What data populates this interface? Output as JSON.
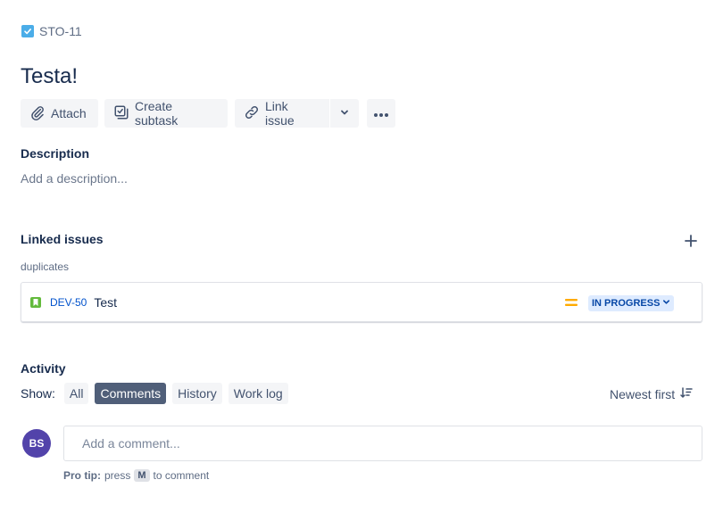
{
  "issue": {
    "key": "STO-11",
    "title": "Testa!"
  },
  "toolbar": {
    "attach_label": "Attach",
    "create_subtask_label": "Create subtask",
    "link_issue_label": "Link issue"
  },
  "description": {
    "heading": "Description",
    "placeholder": "Add a description..."
  },
  "linked_issues": {
    "heading": "Linked issues",
    "link_type": "duplicates",
    "items": [
      {
        "key": "DEV-50",
        "summary": "Test",
        "status": "IN PROGRESS",
        "priority": "medium"
      }
    ]
  },
  "activity": {
    "heading": "Activity",
    "show_label": "Show:",
    "filters": [
      "All",
      "Comments",
      "History",
      "Work log"
    ],
    "active_filter": "Comments",
    "sort_label": "Newest first"
  },
  "comment": {
    "avatar_initials": "BS",
    "placeholder": "Add a comment...",
    "protip_label": "Pro tip:",
    "protip_press": "press",
    "protip_key": "M",
    "protip_suffix": "to comment"
  },
  "colors": {
    "avatar": "#5243aa",
    "status_bg": "#deebff",
    "status_text": "#0747a6",
    "story_icon": "#63ba3c",
    "priority_medium": "#ffab00",
    "active_filter_bg": "#505f79"
  }
}
